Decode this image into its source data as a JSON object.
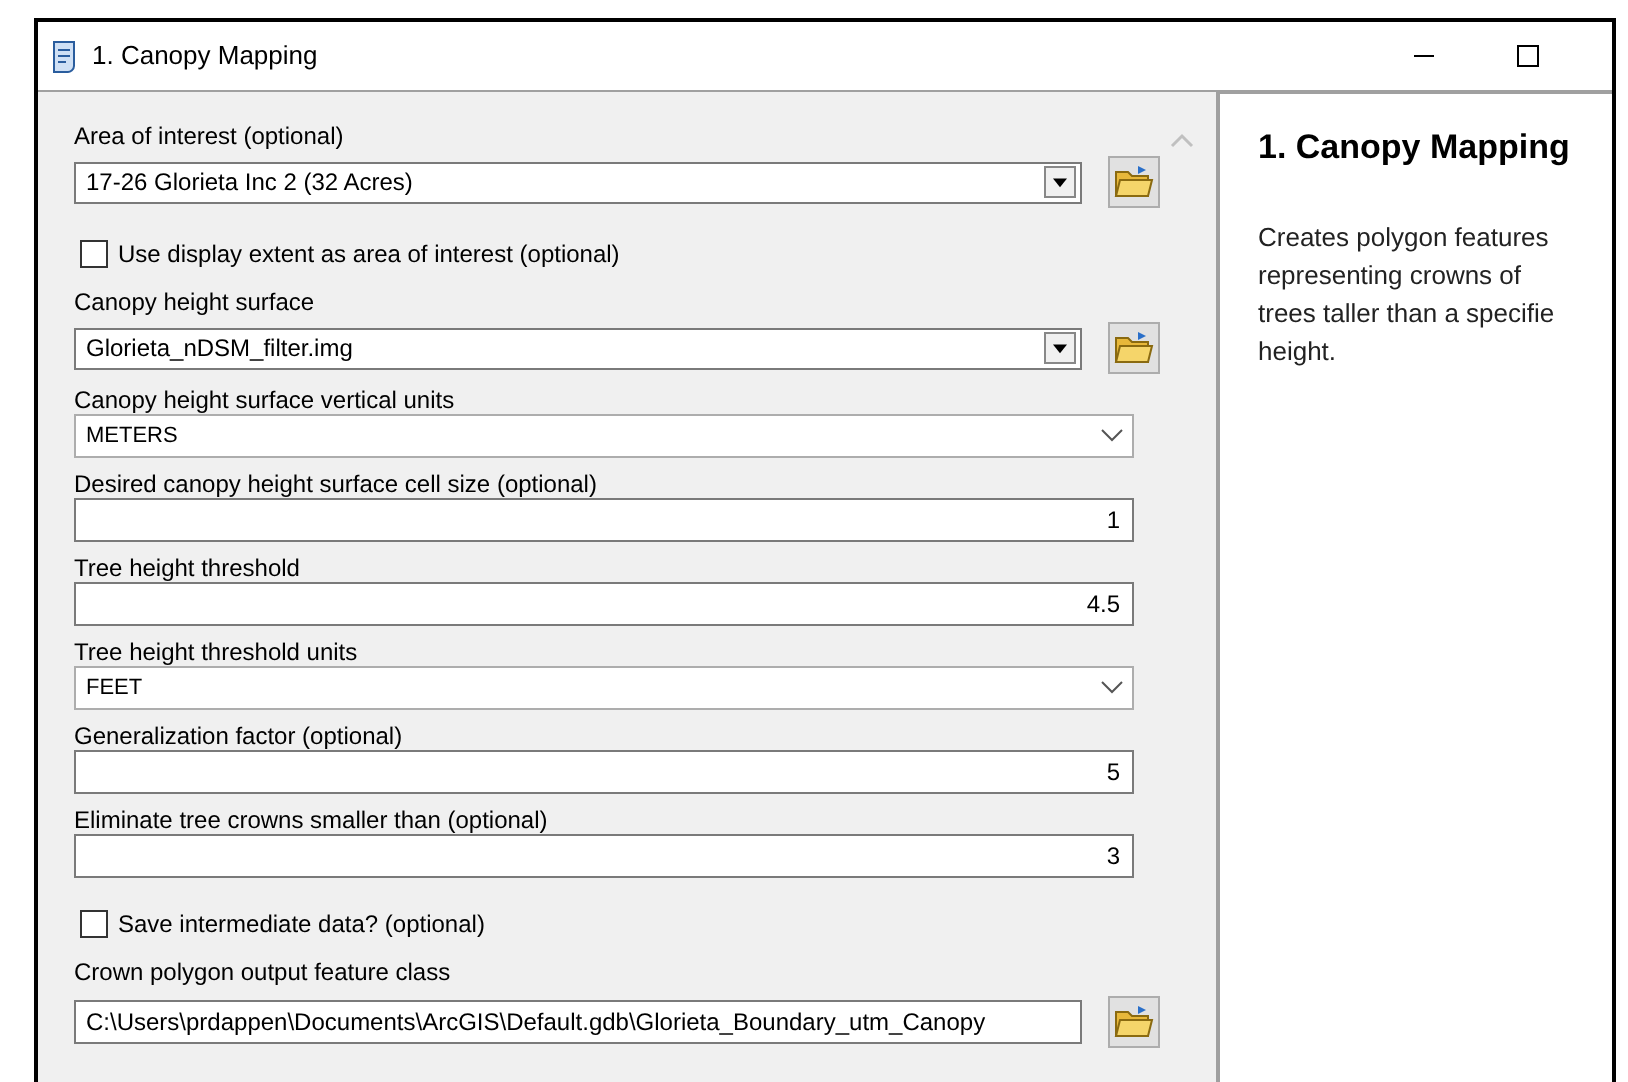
{
  "window": {
    "title": "1. Canopy Mapping"
  },
  "parameters": [
    {
      "kind": "combo_browse",
      "label": "Area of interest (optional)",
      "value": "17-26 Glorieta Inc 2 (32 Acres)"
    },
    {
      "kind": "checkbox",
      "label": "Use display extent as area of interest (optional)",
      "checked": false
    },
    {
      "kind": "combo_browse",
      "label": "Canopy height surface",
      "value": "Glorieta_nDSM_filter.img"
    },
    {
      "kind": "dropdown",
      "label": "Canopy height surface vertical units",
      "value": "METERS"
    },
    {
      "kind": "number",
      "label": "Desired canopy height surface cell size (optional)",
      "value": "1"
    },
    {
      "kind": "number",
      "label": "Tree height threshold",
      "value": "4.5"
    },
    {
      "kind": "dropdown",
      "label": "Tree height threshold units",
      "value": "FEET"
    },
    {
      "kind": "number",
      "label": "Generalization factor (optional)",
      "value": "5"
    },
    {
      "kind": "number",
      "label": "Eliminate tree crowns smaller than (optional)",
      "value": "3"
    },
    {
      "kind": "checkbox",
      "label": "Save intermediate data? (optional)",
      "checked": false
    },
    {
      "kind": "text_browse",
      "label": "Crown polygon output feature class",
      "value": "C:\\Users\\prdappen\\Documents\\ArcGIS\\Default.gdb\\Glorieta_Boundary_utm_Canopy"
    }
  ],
  "help": {
    "title": "1. Canopy Mapping",
    "description_lines": [
      "Creates polygon features",
      "representing crowns of",
      "trees taller than a specifie",
      "height."
    ]
  }
}
